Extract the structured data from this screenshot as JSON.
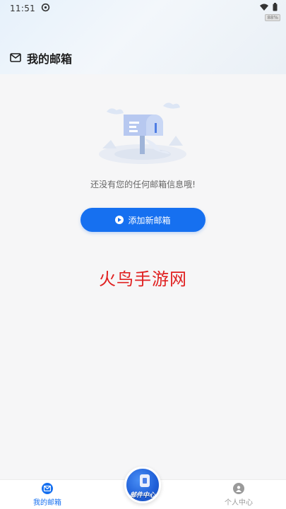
{
  "status_bar": {
    "time": "11:51",
    "battery_tag": "88%"
  },
  "header": {
    "title": "我的邮箱"
  },
  "empty_state": {
    "message": "还没有您的任何邮箱信息哦!",
    "add_button_label": "添加新邮箱"
  },
  "watermark": "火鸟手游网",
  "tab_bar": {
    "tabs": [
      {
        "label": "我的邮箱",
        "icon": "mail-icon",
        "active": true
      },
      {
        "label": "邮件中心",
        "icon": "mail-center-icon",
        "active": false
      },
      {
        "label": "个人中心",
        "icon": "person-icon",
        "active": false
      }
    ]
  },
  "colors": {
    "accent": "#1670f0",
    "watermark": "#e02020",
    "inactive": "#999999"
  }
}
